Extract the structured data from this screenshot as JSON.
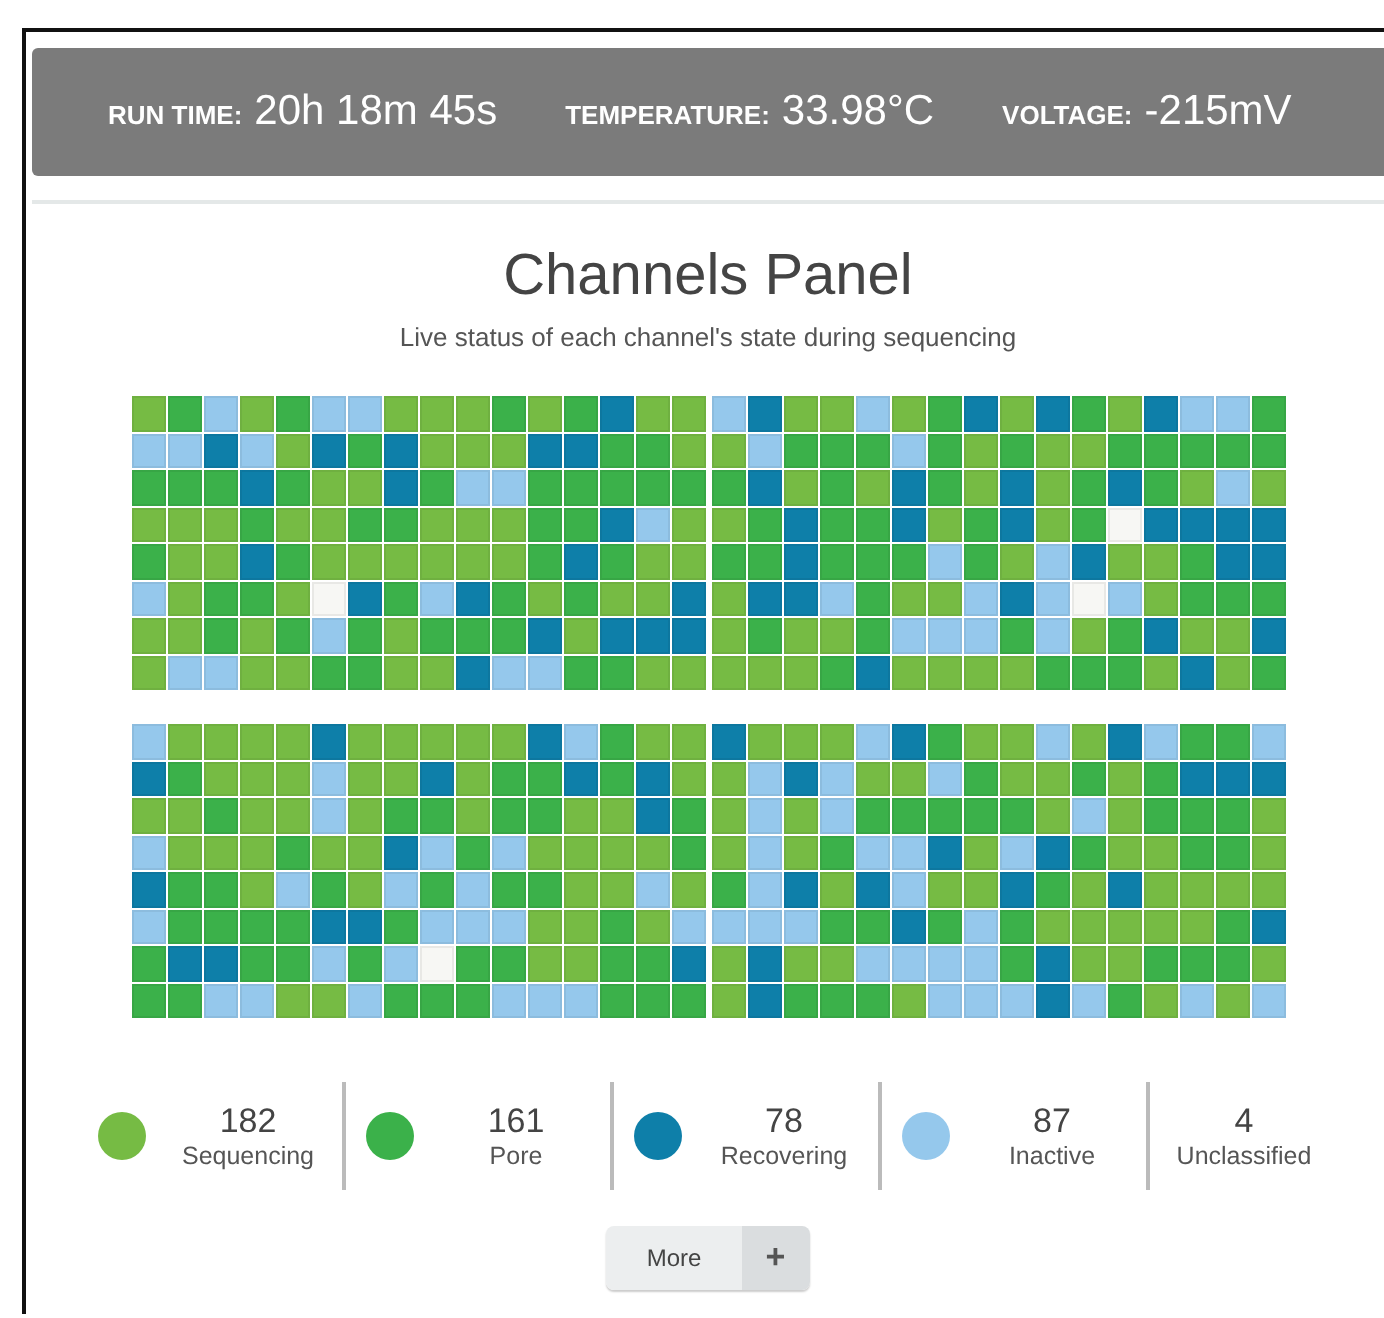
{
  "status_bar": [
    {
      "label": "RUN TIME:",
      "value": "20h 18m 45s"
    },
    {
      "label": "TEMPERATURE:",
      "value": "33.98°C"
    },
    {
      "label": "VOLTAGE:",
      "value": "-215mV"
    }
  ],
  "panel": {
    "title": "Channels Panel",
    "subtitle": "Live status of each channel's state during sequencing"
  },
  "blocks": [
    {
      "rows": [
        [
          {
            "color": "#76bb44"
          },
          {
            "color": "#3bb14a"
          },
          {
            "color": "#95c8ec"
          },
          {
            "color": "#76bb44"
          },
          {
            "color": "#3bb14a"
          },
          {
            "color": "#95c8ec"
          },
          {
            "color": "#95c8ec"
          },
          {
            "color": "#76bb44"
          },
          {
            "color": "#76bb44"
          },
          {
            "color": "#76bb44"
          },
          {
            "color": "#3bb14a"
          },
          {
            "color": "#76bb44"
          },
          {
            "color": "#3bb14a"
          },
          {
            "color": "#0e7fa9"
          },
          {
            "color": "#76bb44"
          },
          {
            "color": "#76bb44"
          },
          {
            "color": "#95c8ec"
          },
          {
            "color": "#0e7fa9"
          },
          {
            "color": "#76bb44"
          },
          {
            "color": "#76bb44"
          },
          {
            "color": "#95c8ec"
          },
          {
            "color": "#76bb44"
          },
          {
            "color": "#3bb14a"
          },
          {
            "color": "#0e7fa9"
          },
          {
            "color": "#76bb44"
          },
          {
            "color": "#0e7fa9"
          },
          {
            "color": "#3bb14a"
          },
          {
            "color": "#76bb44"
          },
          {
            "color": "#0e7fa9"
          },
          {
            "color": "#95c8ec"
          },
          {
            "color": "#95c8ec"
          },
          {
            "color": "#3bb14a"
          }
        ],
        [
          {
            "color": "#95c8ec"
          },
          {
            "color": "#95c8ec"
          },
          {
            "color": "#0e7fa9"
          },
          {
            "color": "#95c8ec"
          },
          {
            "color": "#76bb44"
          },
          {
            "color": "#0e7fa9"
          },
          {
            "color": "#3bb14a"
          },
          {
            "color": "#0e7fa9"
          },
          {
            "color": "#76bb44"
          },
          {
            "color": "#76bb44"
          },
          {
            "color": "#76bb44"
          },
          {
            "color": "#0e7fa9"
          },
          {
            "color": "#0e7fa9"
          },
          {
            "color": "#3bb14a"
          },
          {
            "color": "#3bb14a"
          },
          {
            "color": "#76bb44"
          },
          {
            "color": "#76bb44"
          },
          {
            "color": "#95c8ec"
          },
          {
            "color": "#3bb14a"
          },
          {
            "color": "#3bb14a"
          },
          {
            "color": "#3bb14a"
          },
          {
            "color": "#95c8ec"
          },
          {
            "color": "#3bb14a"
          },
          {
            "color": "#76bb44"
          },
          {
            "color": "#3bb14a"
          },
          {
            "color": "#76bb44"
          },
          {
            "color": "#76bb44"
          },
          {
            "color": "#3bb14a"
          },
          {
            "color": "#3bb14a"
          },
          {
            "color": "#3bb14a"
          },
          {
            "color": "#3bb14a"
          },
          {
            "color": "#3bb14a"
          }
        ],
        [
          {
            "color": "#3bb14a"
          },
          {
            "color": "#3bb14a"
          },
          {
            "color": "#3bb14a"
          },
          {
            "color": "#0e7fa9"
          },
          {
            "color": "#3bb14a"
          },
          {
            "color": "#76bb44"
          },
          {
            "color": "#76bb44"
          },
          {
            "color": "#0e7fa9"
          },
          {
            "color": "#3bb14a"
          },
          {
            "color": "#95c8ec"
          },
          {
            "color": "#95c8ec"
          },
          {
            "color": "#3bb14a"
          },
          {
            "color": "#3bb14a"
          },
          {
            "color": "#3bb14a"
          },
          {
            "color": "#3bb14a"
          },
          {
            "color": "#3bb14a"
          },
          {
            "color": "#3bb14a"
          },
          {
            "color": "#0e7fa9"
          },
          {
            "color": "#76bb44"
          },
          {
            "color": "#3bb14a"
          },
          {
            "color": "#76bb44"
          },
          {
            "color": "#0e7fa9"
          },
          {
            "color": "#3bb14a"
          },
          {
            "color": "#76bb44"
          },
          {
            "color": "#0e7fa9"
          },
          {
            "color": "#76bb44"
          },
          {
            "color": "#3bb14a"
          },
          {
            "color": "#0e7fa9"
          },
          {
            "color": "#3bb14a"
          },
          {
            "color": "#76bb44"
          },
          {
            "color": "#95c8ec"
          },
          {
            "color": "#76bb44"
          }
        ],
        [
          {
            "color": "#76bb44"
          },
          {
            "color": "#76bb44"
          },
          {
            "color": "#76bb44"
          },
          {
            "color": "#3bb14a"
          },
          {
            "color": "#76bb44"
          },
          {
            "color": "#76bb44"
          },
          {
            "color": "#3bb14a"
          },
          {
            "color": "#3bb14a"
          },
          {
            "color": "#76bb44"
          },
          {
            "color": "#76bb44"
          },
          {
            "color": "#76bb44"
          },
          {
            "color": "#3bb14a"
          },
          {
            "color": "#3bb14a"
          },
          {
            "color": "#0e7fa9"
          },
          {
            "color": "#95c8ec"
          },
          {
            "color": "#76bb44"
          },
          {
            "color": "#76bb44"
          },
          {
            "color": "#3bb14a"
          },
          {
            "color": "#0e7fa9"
          },
          {
            "color": "#3bb14a"
          },
          {
            "color": "#3bb14a"
          },
          {
            "color": "#0e7fa9"
          },
          {
            "color": "#76bb44"
          },
          {
            "color": "#3bb14a"
          },
          {
            "color": "#0e7fa9"
          },
          {
            "color": "#76bb44"
          },
          {
            "color": "#3bb14a"
          },
          {
            "color": "#f7f7f4"
          },
          {
            "color": "#0e7fa9"
          },
          {
            "color": "#0e7fa9"
          },
          {
            "color": "#0e7fa9"
          },
          {
            "color": "#0e7fa9"
          }
        ],
        [
          {
            "color": "#3bb14a"
          },
          {
            "color": "#76bb44"
          },
          {
            "color": "#76bb44"
          },
          {
            "color": "#0e7fa9"
          },
          {
            "color": "#3bb14a"
          },
          {
            "color": "#76bb44"
          },
          {
            "color": "#76bb44"
          },
          {
            "color": "#76bb44"
          },
          {
            "color": "#76bb44"
          },
          {
            "color": "#76bb44"
          },
          {
            "color": "#76bb44"
          },
          {
            "color": "#3bb14a"
          },
          {
            "color": "#0e7fa9"
          },
          {
            "color": "#3bb14a"
          },
          {
            "color": "#76bb44"
          },
          {
            "color": "#76bb44"
          },
          {
            "color": "#3bb14a"
          },
          {
            "color": "#3bb14a"
          },
          {
            "color": "#0e7fa9"
          },
          {
            "color": "#3bb14a"
          },
          {
            "color": "#3bb14a"
          },
          {
            "color": "#3bb14a"
          },
          {
            "color": "#95c8ec"
          },
          {
            "color": "#3bb14a"
          },
          {
            "color": "#76bb44"
          },
          {
            "color": "#95c8ec"
          },
          {
            "color": "#0e7fa9"
          },
          {
            "color": "#76bb44"
          },
          {
            "color": "#76bb44"
          },
          {
            "color": "#3bb14a"
          },
          {
            "color": "#0e7fa9"
          },
          {
            "color": "#0e7fa9"
          }
        ],
        [
          {
            "color": "#95c8ec"
          },
          {
            "color": "#76bb44"
          },
          {
            "color": "#3bb14a"
          },
          {
            "color": "#3bb14a"
          },
          {
            "color": "#76bb44"
          },
          {
            "color": "#f7f7f4"
          },
          {
            "color": "#0e7fa9"
          },
          {
            "color": "#3bb14a"
          },
          {
            "color": "#95c8ec"
          },
          {
            "color": "#0e7fa9"
          },
          {
            "color": "#3bb14a"
          },
          {
            "color": "#76bb44"
          },
          {
            "color": "#3bb14a"
          },
          {
            "color": "#76bb44"
          },
          {
            "color": "#76bb44"
          },
          {
            "color": "#0e7fa9"
          },
          {
            "color": "#76bb44"
          },
          {
            "color": "#0e7fa9"
          },
          {
            "color": "#0e7fa9"
          },
          {
            "color": "#95c8ec"
          },
          {
            "color": "#3bb14a"
          },
          {
            "color": "#76bb44"
          },
          {
            "color": "#76bb44"
          },
          {
            "color": "#95c8ec"
          },
          {
            "color": "#0e7fa9"
          },
          {
            "color": "#95c8ec"
          },
          {
            "color": "#f7f7f4"
          },
          {
            "color": "#95c8ec"
          },
          {
            "color": "#76bb44"
          },
          {
            "color": "#3bb14a"
          },
          {
            "color": "#3bb14a"
          },
          {
            "color": "#3bb14a"
          }
        ],
        [
          {
            "color": "#76bb44"
          },
          {
            "color": "#76bb44"
          },
          {
            "color": "#3bb14a"
          },
          {
            "color": "#76bb44"
          },
          {
            "color": "#3bb14a"
          },
          {
            "color": "#95c8ec"
          },
          {
            "color": "#3bb14a"
          },
          {
            "color": "#76bb44"
          },
          {
            "color": "#3bb14a"
          },
          {
            "color": "#3bb14a"
          },
          {
            "color": "#3bb14a"
          },
          {
            "color": "#0e7fa9"
          },
          {
            "color": "#76bb44"
          },
          {
            "color": "#0e7fa9"
          },
          {
            "color": "#0e7fa9"
          },
          {
            "color": "#0e7fa9"
          },
          {
            "color": "#76bb44"
          },
          {
            "color": "#3bb14a"
          },
          {
            "color": "#76bb44"
          },
          {
            "color": "#76bb44"
          },
          {
            "color": "#3bb14a"
          },
          {
            "color": "#95c8ec"
          },
          {
            "color": "#95c8ec"
          },
          {
            "color": "#95c8ec"
          },
          {
            "color": "#3bb14a"
          },
          {
            "color": "#95c8ec"
          },
          {
            "color": "#76bb44"
          },
          {
            "color": "#3bb14a"
          },
          {
            "color": "#0e7fa9"
          },
          {
            "color": "#76bb44"
          },
          {
            "color": "#76bb44"
          },
          {
            "color": "#0e7fa9"
          }
        ],
        [
          {
            "color": "#76bb44"
          },
          {
            "color": "#95c8ec"
          },
          {
            "color": "#95c8ec"
          },
          {
            "color": "#76bb44"
          },
          {
            "color": "#76bb44"
          },
          {
            "color": "#3bb14a"
          },
          {
            "color": "#3bb14a"
          },
          {
            "color": "#76bb44"
          },
          {
            "color": "#76bb44"
          },
          {
            "color": "#0e7fa9"
          },
          {
            "color": "#95c8ec"
          },
          {
            "color": "#95c8ec"
          },
          {
            "color": "#3bb14a"
          },
          {
            "color": "#3bb14a"
          },
          {
            "color": "#76bb44"
          },
          {
            "color": "#76bb44"
          },
          {
            "color": "#76bb44"
          },
          {
            "color": "#76bb44"
          },
          {
            "color": "#76bb44"
          },
          {
            "color": "#3bb14a"
          },
          {
            "color": "#0e7fa9"
          },
          {
            "color": "#76bb44"
          },
          {
            "color": "#76bb44"
          },
          {
            "color": "#76bb44"
          },
          {
            "color": "#76bb44"
          },
          {
            "color": "#3bb14a"
          },
          {
            "color": "#3bb14a"
          },
          {
            "color": "#3bb14a"
          },
          {
            "color": "#76bb44"
          },
          {
            "color": "#0e7fa9"
          },
          {
            "color": "#76bb44"
          },
          {
            "color": "#3bb14a"
          }
        ]
      ]
    },
    {
      "rows": [
        [
          {
            "color": "#95c8ec"
          },
          {
            "color": "#76bb44"
          },
          {
            "color": "#76bb44"
          },
          {
            "color": "#76bb44"
          },
          {
            "color": "#76bb44"
          },
          {
            "color": "#0e7fa9"
          },
          {
            "color": "#76bb44"
          },
          {
            "color": "#76bb44"
          },
          {
            "color": "#76bb44"
          },
          {
            "color": "#76bb44"
          },
          {
            "color": "#76bb44"
          },
          {
            "color": "#0e7fa9"
          },
          {
            "color": "#95c8ec"
          },
          {
            "color": "#3bb14a"
          },
          {
            "color": "#76bb44"
          },
          {
            "color": "#76bb44"
          },
          {
            "color": "#0e7fa9"
          },
          {
            "color": "#76bb44"
          },
          {
            "color": "#76bb44"
          },
          {
            "color": "#76bb44"
          },
          {
            "color": "#95c8ec"
          },
          {
            "color": "#0e7fa9"
          },
          {
            "color": "#3bb14a"
          },
          {
            "color": "#76bb44"
          },
          {
            "color": "#76bb44"
          },
          {
            "color": "#95c8ec"
          },
          {
            "color": "#76bb44"
          },
          {
            "color": "#0e7fa9"
          },
          {
            "color": "#95c8ec"
          },
          {
            "color": "#3bb14a"
          },
          {
            "color": "#3bb14a"
          },
          {
            "color": "#95c8ec"
          }
        ],
        [
          {
            "color": "#0e7fa9"
          },
          {
            "color": "#3bb14a"
          },
          {
            "color": "#76bb44"
          },
          {
            "color": "#76bb44"
          },
          {
            "color": "#76bb44"
          },
          {
            "color": "#95c8ec"
          },
          {
            "color": "#76bb44"
          },
          {
            "color": "#76bb44"
          },
          {
            "color": "#0e7fa9"
          },
          {
            "color": "#76bb44"
          },
          {
            "color": "#3bb14a"
          },
          {
            "color": "#3bb14a"
          },
          {
            "color": "#0e7fa9"
          },
          {
            "color": "#3bb14a"
          },
          {
            "color": "#0e7fa9"
          },
          {
            "color": "#76bb44"
          },
          {
            "color": "#76bb44"
          },
          {
            "color": "#95c8ec"
          },
          {
            "color": "#0e7fa9"
          },
          {
            "color": "#95c8ec"
          },
          {
            "color": "#76bb44"
          },
          {
            "color": "#76bb44"
          },
          {
            "color": "#95c8ec"
          },
          {
            "color": "#3bb14a"
          },
          {
            "color": "#76bb44"
          },
          {
            "color": "#76bb44"
          },
          {
            "color": "#3bb14a"
          },
          {
            "color": "#76bb44"
          },
          {
            "color": "#3bb14a"
          },
          {
            "color": "#0e7fa9"
          },
          {
            "color": "#0e7fa9"
          },
          {
            "color": "#0e7fa9"
          }
        ],
        [
          {
            "color": "#76bb44"
          },
          {
            "color": "#76bb44"
          },
          {
            "color": "#3bb14a"
          },
          {
            "color": "#76bb44"
          },
          {
            "color": "#76bb44"
          },
          {
            "color": "#95c8ec"
          },
          {
            "color": "#76bb44"
          },
          {
            "color": "#3bb14a"
          },
          {
            "color": "#3bb14a"
          },
          {
            "color": "#76bb44"
          },
          {
            "color": "#3bb14a"
          },
          {
            "color": "#3bb14a"
          },
          {
            "color": "#76bb44"
          },
          {
            "color": "#76bb44"
          },
          {
            "color": "#0e7fa9"
          },
          {
            "color": "#3bb14a"
          },
          {
            "color": "#76bb44"
          },
          {
            "color": "#95c8ec"
          },
          {
            "color": "#76bb44"
          },
          {
            "color": "#95c8ec"
          },
          {
            "color": "#3bb14a"
          },
          {
            "color": "#3bb14a"
          },
          {
            "color": "#3bb14a"
          },
          {
            "color": "#3bb14a"
          },
          {
            "color": "#3bb14a"
          },
          {
            "color": "#76bb44"
          },
          {
            "color": "#95c8ec"
          },
          {
            "color": "#76bb44"
          },
          {
            "color": "#3bb14a"
          },
          {
            "color": "#3bb14a"
          },
          {
            "color": "#3bb14a"
          },
          {
            "color": "#76bb44"
          }
        ],
        [
          {
            "color": "#95c8ec"
          },
          {
            "color": "#76bb44"
          },
          {
            "color": "#76bb44"
          },
          {
            "color": "#76bb44"
          },
          {
            "color": "#3bb14a"
          },
          {
            "color": "#76bb44"
          },
          {
            "color": "#76bb44"
          },
          {
            "color": "#0e7fa9"
          },
          {
            "color": "#95c8ec"
          },
          {
            "color": "#3bb14a"
          },
          {
            "color": "#95c8ec"
          },
          {
            "color": "#76bb44"
          },
          {
            "color": "#76bb44"
          },
          {
            "color": "#76bb44"
          },
          {
            "color": "#76bb44"
          },
          {
            "color": "#3bb14a"
          },
          {
            "color": "#76bb44"
          },
          {
            "color": "#95c8ec"
          },
          {
            "color": "#76bb44"
          },
          {
            "color": "#3bb14a"
          },
          {
            "color": "#95c8ec"
          },
          {
            "color": "#95c8ec"
          },
          {
            "color": "#0e7fa9"
          },
          {
            "color": "#76bb44"
          },
          {
            "color": "#95c8ec"
          },
          {
            "color": "#0e7fa9"
          },
          {
            "color": "#3bb14a"
          },
          {
            "color": "#76bb44"
          },
          {
            "color": "#76bb44"
          },
          {
            "color": "#3bb14a"
          },
          {
            "color": "#3bb14a"
          },
          {
            "color": "#76bb44"
          }
        ],
        [
          {
            "color": "#0e7fa9"
          },
          {
            "color": "#3bb14a"
          },
          {
            "color": "#3bb14a"
          },
          {
            "color": "#76bb44"
          },
          {
            "color": "#95c8ec"
          },
          {
            "color": "#3bb14a"
          },
          {
            "color": "#76bb44"
          },
          {
            "color": "#95c8ec"
          },
          {
            "color": "#3bb14a"
          },
          {
            "color": "#95c8ec"
          },
          {
            "color": "#3bb14a"
          },
          {
            "color": "#3bb14a"
          },
          {
            "color": "#76bb44"
          },
          {
            "color": "#76bb44"
          },
          {
            "color": "#95c8ec"
          },
          {
            "color": "#76bb44"
          },
          {
            "color": "#3bb14a"
          },
          {
            "color": "#95c8ec"
          },
          {
            "color": "#0e7fa9"
          },
          {
            "color": "#76bb44"
          },
          {
            "color": "#0e7fa9"
          },
          {
            "color": "#95c8ec"
          },
          {
            "color": "#76bb44"
          },
          {
            "color": "#76bb44"
          },
          {
            "color": "#0e7fa9"
          },
          {
            "color": "#3bb14a"
          },
          {
            "color": "#76bb44"
          },
          {
            "color": "#0e7fa9"
          },
          {
            "color": "#76bb44"
          },
          {
            "color": "#76bb44"
          },
          {
            "color": "#76bb44"
          },
          {
            "color": "#76bb44"
          }
        ],
        [
          {
            "color": "#95c8ec"
          },
          {
            "color": "#3bb14a"
          },
          {
            "color": "#3bb14a"
          },
          {
            "color": "#3bb14a"
          },
          {
            "color": "#3bb14a"
          },
          {
            "color": "#0e7fa9"
          },
          {
            "color": "#0e7fa9"
          },
          {
            "color": "#3bb14a"
          },
          {
            "color": "#95c8ec"
          },
          {
            "color": "#95c8ec"
          },
          {
            "color": "#95c8ec"
          },
          {
            "color": "#76bb44"
          },
          {
            "color": "#76bb44"
          },
          {
            "color": "#3bb14a"
          },
          {
            "color": "#76bb44"
          },
          {
            "color": "#95c8ec"
          },
          {
            "color": "#95c8ec"
          },
          {
            "color": "#95c8ec"
          },
          {
            "color": "#95c8ec"
          },
          {
            "color": "#3bb14a"
          },
          {
            "color": "#3bb14a"
          },
          {
            "color": "#0e7fa9"
          },
          {
            "color": "#3bb14a"
          },
          {
            "color": "#95c8ec"
          },
          {
            "color": "#3bb14a"
          },
          {
            "color": "#76bb44"
          },
          {
            "color": "#76bb44"
          },
          {
            "color": "#76bb44"
          },
          {
            "color": "#76bb44"
          },
          {
            "color": "#76bb44"
          },
          {
            "color": "#3bb14a"
          },
          {
            "color": "#0e7fa9"
          }
        ],
        [
          {
            "color": "#3bb14a"
          },
          {
            "color": "#0e7fa9"
          },
          {
            "color": "#0e7fa9"
          },
          {
            "color": "#3bb14a"
          },
          {
            "color": "#3bb14a"
          },
          {
            "color": "#95c8ec"
          },
          {
            "color": "#3bb14a"
          },
          {
            "color": "#95c8ec"
          },
          {
            "color": "#f7f7f4"
          },
          {
            "color": "#3bb14a"
          },
          {
            "color": "#3bb14a"
          },
          {
            "color": "#76bb44"
          },
          {
            "color": "#76bb44"
          },
          {
            "color": "#3bb14a"
          },
          {
            "color": "#3bb14a"
          },
          {
            "color": "#0e7fa9"
          },
          {
            "color": "#76bb44"
          },
          {
            "color": "#0e7fa9"
          },
          {
            "color": "#76bb44"
          },
          {
            "color": "#76bb44"
          },
          {
            "color": "#95c8ec"
          },
          {
            "color": "#95c8ec"
          },
          {
            "color": "#95c8ec"
          },
          {
            "color": "#95c8ec"
          },
          {
            "color": "#3bb14a"
          },
          {
            "color": "#0e7fa9"
          },
          {
            "color": "#76bb44"
          },
          {
            "color": "#76bb44"
          },
          {
            "color": "#3bb14a"
          },
          {
            "color": "#3bb14a"
          },
          {
            "color": "#3bb14a"
          },
          {
            "color": "#76bb44"
          }
        ],
        [
          {
            "color": "#3bb14a"
          },
          {
            "color": "#3bb14a"
          },
          {
            "color": "#95c8ec"
          },
          {
            "color": "#95c8ec"
          },
          {
            "color": "#76bb44"
          },
          {
            "color": "#76bb44"
          },
          {
            "color": "#95c8ec"
          },
          {
            "color": "#3bb14a"
          },
          {
            "color": "#3bb14a"
          },
          {
            "color": "#3bb14a"
          },
          {
            "color": "#95c8ec"
          },
          {
            "color": "#95c8ec"
          },
          {
            "color": "#95c8ec"
          },
          {
            "color": "#3bb14a"
          },
          {
            "color": "#3bb14a"
          },
          {
            "color": "#3bb14a"
          },
          {
            "color": "#76bb44"
          },
          {
            "color": "#0e7fa9"
          },
          {
            "color": "#3bb14a"
          },
          {
            "color": "#3bb14a"
          },
          {
            "color": "#3bb14a"
          },
          {
            "color": "#76bb44"
          },
          {
            "color": "#95c8ec"
          },
          {
            "color": "#95c8ec"
          },
          {
            "color": "#95c8ec"
          },
          {
            "color": "#0e7fa9"
          },
          {
            "color": "#95c8ec"
          },
          {
            "color": "#3bb14a"
          },
          {
            "color": "#76bb44"
          },
          {
            "color": "#95c8ec"
          },
          {
            "color": "#76bb44"
          },
          {
            "color": "#95c8ec"
          }
        ]
      ]
    }
  ],
  "legend": [
    {
      "count": "182",
      "label": "Sequencing",
      "color": "#76bb44"
    },
    {
      "count": "161",
      "label": "Pore",
      "color": "#3bb14a"
    },
    {
      "count": "78",
      "label": "Recovering",
      "color": "#0e7fa9"
    },
    {
      "count": "87",
      "label": "Inactive",
      "color": "#95c8ec"
    },
    {
      "count": "4",
      "label": "Unclassified"
    }
  ],
  "more_button": {
    "label": "More",
    "icon": "+"
  }
}
